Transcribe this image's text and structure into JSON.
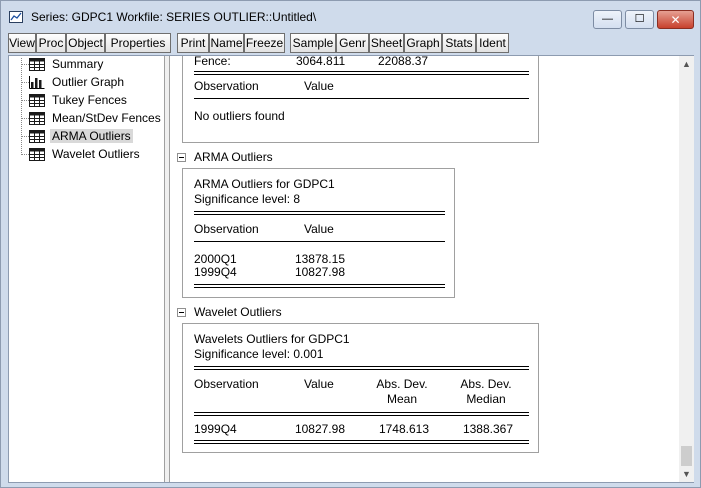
{
  "window": {
    "title": "Series: GDPC1   Workfile: SERIES OUTLIER::Untitled\\",
    "controls": {
      "minimize": "—",
      "maximize": "☐",
      "close": "✕"
    }
  },
  "toolbar": {
    "buttons": [
      "View",
      "Proc",
      "Object",
      "Properties",
      "Print",
      "Name",
      "Freeze",
      "Sample",
      "Genr",
      "Sheet",
      "Graph",
      "Stats",
      "Ident"
    ]
  },
  "tree": {
    "items": [
      {
        "label": "Summary",
        "icon": "table-icon",
        "selected": false
      },
      {
        "label": "Outlier Graph",
        "icon": "bar-graph-icon",
        "selected": false
      },
      {
        "label": "Tukey Fences",
        "icon": "table-icon",
        "selected": false
      },
      {
        "label": "Mean/StDev Fences",
        "icon": "table-icon",
        "selected": false
      },
      {
        "label": "ARMA Outliers",
        "icon": "table-icon",
        "selected": true
      },
      {
        "label": "Wavelet Outliers",
        "icon": "table-icon",
        "selected": false
      }
    ]
  },
  "fence_section": {
    "fence_label": "Fence:",
    "fence_low": "3064.811",
    "fence_high": "22088.37",
    "col_observation": "Observation",
    "col_value": "Value",
    "message": "No outliers found"
  },
  "arma_section": {
    "heading": "ARMA Outliers",
    "title": "ARMA Outliers for GDPC1",
    "significance": "Significance level: 8",
    "col_observation": "Observation",
    "col_value": "Value",
    "rows": [
      {
        "observation": "2000Q1",
        "value": "13878.15"
      },
      {
        "observation": "1999Q4",
        "value": "10827.98"
      }
    ]
  },
  "wavelet_section": {
    "heading": "Wavelet Outliers",
    "title": "Wavelets Outliers for GDPC1",
    "significance": "Significance level: 0.001",
    "col_observation": "Observation",
    "col_value": "Value",
    "col_absdev_mean_1": "Abs. Dev.",
    "col_absdev_mean_2": "Mean",
    "col_absdev_median_1": "Abs. Dev.",
    "col_absdev_median_2": "Median",
    "rows": [
      {
        "observation": "1999Q4",
        "value": "10827.98",
        "absdev_mean": "1748.613",
        "absdev_median": "1388.367"
      }
    ]
  },
  "scrollbar": {
    "up": "▲",
    "down": "▼"
  }
}
